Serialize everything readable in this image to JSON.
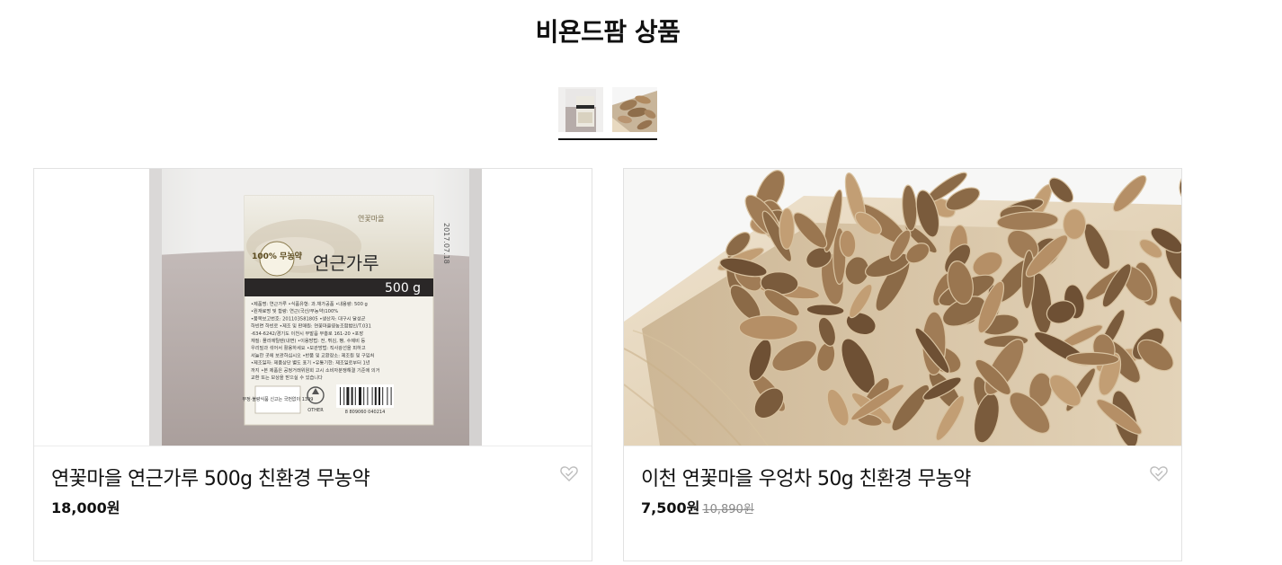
{
  "section": {
    "title": "비욘드팜 상품"
  },
  "thumbnails": [
    {
      "label": "연근가루 썸네일"
    },
    {
      "label": "우엉차 썸네일"
    }
  ],
  "products": [
    {
      "name": "연꽃마을 연근가루 500g 친환경 무농약",
      "price": "18,000원",
      "original_price": "",
      "package": {
        "brand_seal": "연꽃마을",
        "product_label": "연근가루",
        "weight": "500 g",
        "badge": "100% 무농약",
        "date": "2017.07.18",
        "recycle": "OTHER",
        "barcode": "8 809060 040214",
        "report": "부정·불량식품 신고는 국번없이 1399",
        "info_lines": [
          "•제품명: 연근가루 •식품유형: 과.채가공품 •내용량: 500 g",
          "•원재료명 및 함량: 연근(국산/무농약)100%",
          "•품목보고번호: 201103581805 •생산자: 대구시 달성군",
          "하빈면 하빈로 •제조 및 판매원: 연꽃마을영농조합법인/T.031",
          "-634-6242/경기도 이천시 부발읍 부흥로 161-20 •포장",
          "재질: 폴리에틸렌(내면) •이용방법: 전, 튀김, 빵, 수제비 등",
          "우리밀과 섞어서 활용하세요 •보관방법: 직사광선을 피하고",
          "서늘한 곳에 보관하십시오 •반품 및 교환장소: 제조원 및 구입처",
          "•제조일자: 제품상단 별도 표기 •유통기한: 제조일로부터 1년",
          "까지 •본 제품은 공정거래위원회 고시 소비자분쟁해결 기준에 의거",
          "교환 또는 보상을 받으실 수 있습니다"
        ]
      }
    },
    {
      "name": "이천 연꽃마을 우엉차 50g 친환경 무농약",
      "price": "7,500원",
      "original_price": "10,890원"
    }
  ],
  "icons": {
    "wishlist": "heart-check-icon"
  },
  "colors": {
    "text": "#111111",
    "border": "#e2e2e2",
    "strike": "#8a8a8a"
  }
}
